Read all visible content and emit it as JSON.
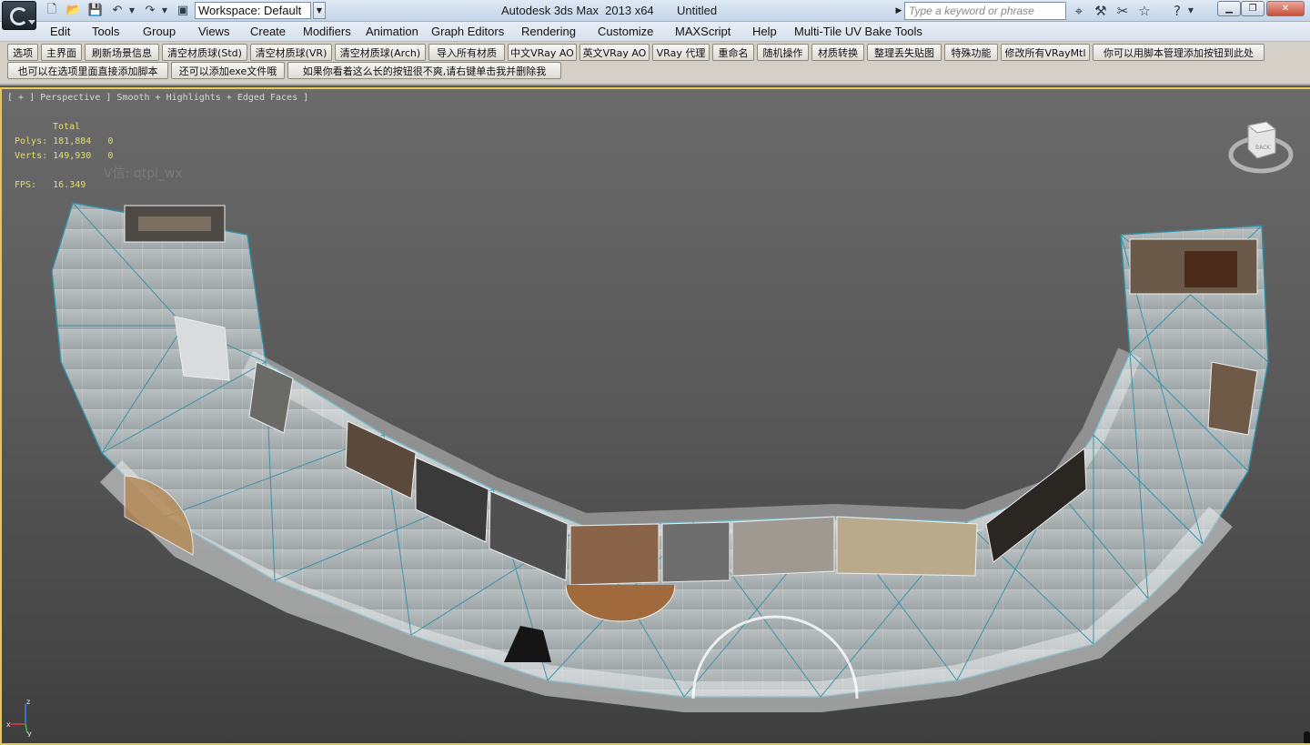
{
  "titlebar": {
    "workspace_value": "Workspace: Default",
    "app_title": "Autodesk 3ds Max  2013 x64",
    "document": "Untitled",
    "search_placeholder": "Type a keyword or phrase"
  },
  "menu": {
    "items": [
      "Edit",
      "Tools",
      "Group",
      "Views",
      "Create",
      "Modifiers",
      "Animation",
      "Graph Editors",
      "Rendering",
      "Customize",
      "MAXScript",
      "Help",
      "Multi-Tile UV Bake Tools"
    ]
  },
  "toolbar": {
    "row1": [
      "选项",
      "主界面",
      "刷新场景信息",
      "清空材质球(Std)",
      "清空材质球(VR)",
      "清空材质球(Arch)",
      "导入所有材质",
      "中文VRay AO",
      "英文VRay AO",
      "VRay 代理",
      "重命名",
      "随机操作",
      "材质转换",
      "整理丢失贴图",
      "特殊功能",
      "修改所有VRayMtl",
      "你可以用脚本管理添加按钮到此处"
    ],
    "row2": [
      "也可以在选项里面直接添加脚本",
      "还可以添加exe文件哦",
      "如果你看着这么长的按钮很不爽,请右键单击我并删除我"
    ]
  },
  "viewport": {
    "label": "[ + ] Perspective ] Smooth + Highlights + Edged Faces ]",
    "stats": {
      "header": "Total",
      "polys_label": "Polys:",
      "polys_total": "181,884",
      "polys_sel": "0",
      "verts_label": "Verts:",
      "verts_total": "149,930",
      "verts_sel": "0",
      "fps_label": "FPS:",
      "fps_value": "16.349"
    },
    "watermark": "V信: qtpl_wx",
    "viewcube_label": "BACK",
    "axis": {
      "x": "x",
      "y": "y",
      "z": "z"
    }
  },
  "colors": {
    "viewport_border": "#e7c84a",
    "stats_text": "#e6df63",
    "wire": "#2e8fa6"
  },
  "icons": [
    "new-file-icon",
    "open-file-icon",
    "save-icon",
    "undo-icon",
    "redo-icon",
    "project-folder-icon",
    "binoculars-icon",
    "tools-icon",
    "star-icon",
    "help-icon"
  ]
}
